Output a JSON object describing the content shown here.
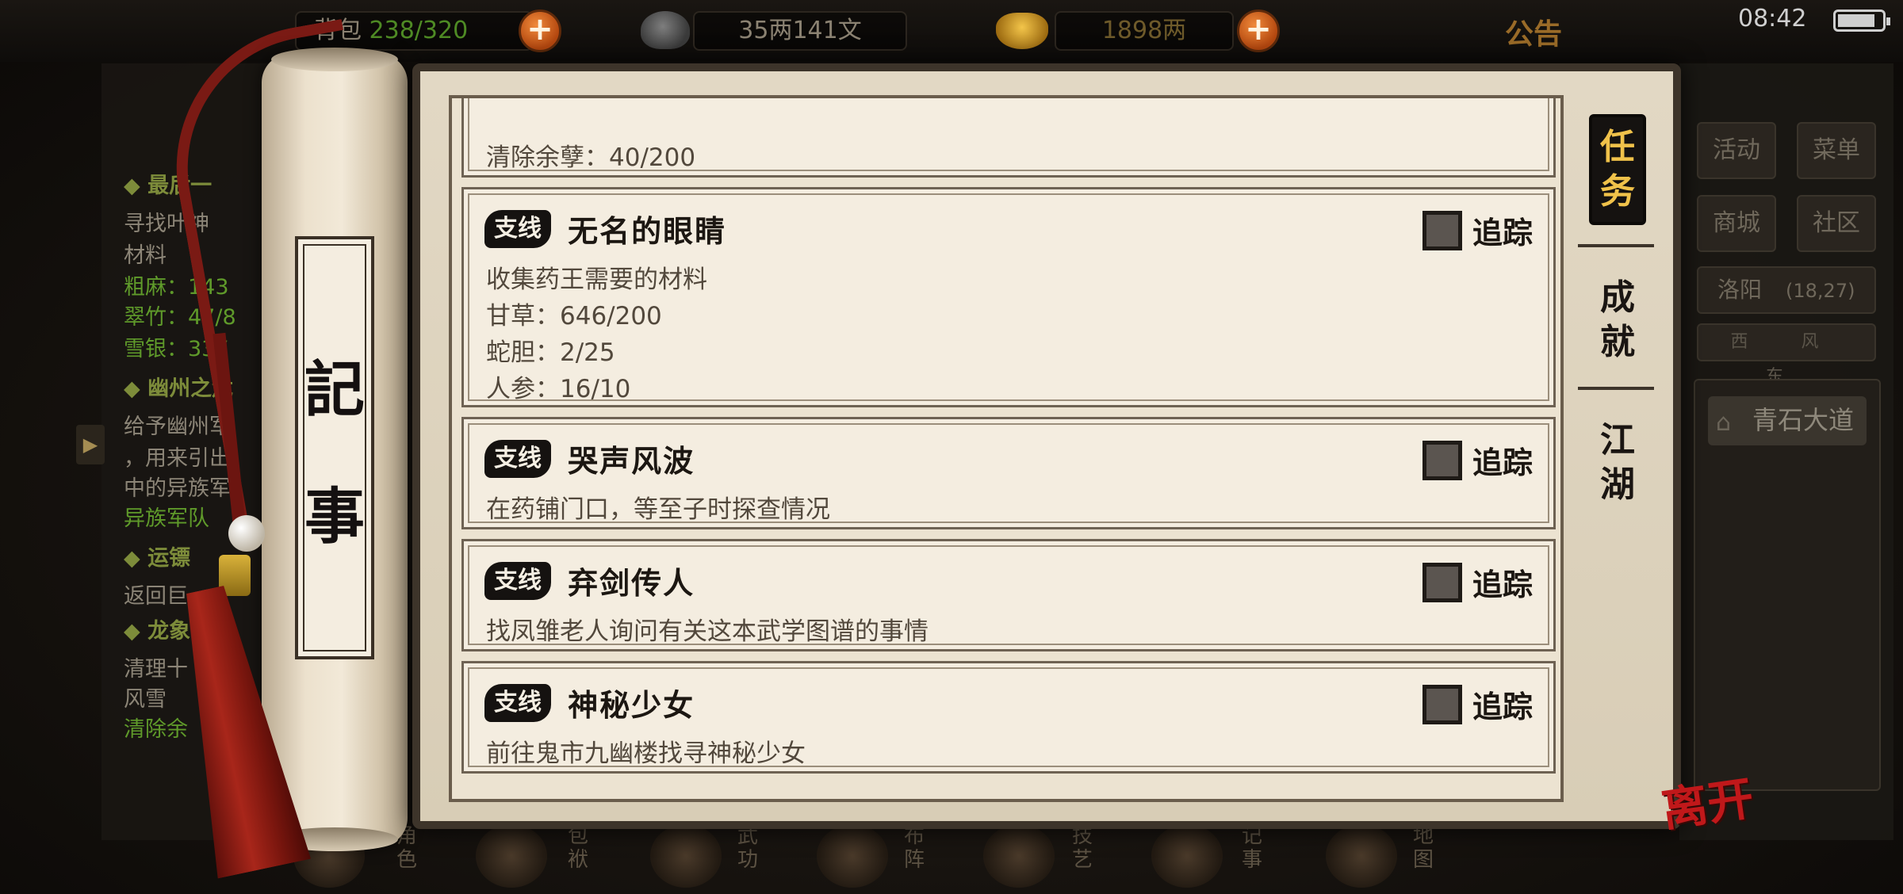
{
  "topbar": {
    "bag_label": "背包",
    "bag_count": "238/320",
    "silver": "35两141文",
    "gold": "1898两",
    "notice": "公告",
    "time": "08:42"
  },
  "left_panel": {
    "quests": [
      {
        "head": "◆ 最后一",
        "lines": [
          "寻找叶神",
          "材料",
          "粗麻：143",
          "翠竹：47/8",
          "雪银：337"
        ]
      },
      {
        "head": "◆ 幽州之危",
        "lines": [
          "给予幽州军",
          "，用来引出",
          "中的异族军",
          "异族军队"
        ]
      },
      {
        "head": "◆ 运镖",
        "lines": [
          "返回巨"
        ]
      },
      {
        "head": "◆ 龙象",
        "lines": [
          "清理十",
          "风雪",
          "清除余"
        ]
      }
    ]
  },
  "right_panel": {
    "activity": "活动",
    "menu": "菜单",
    "shop": "商城",
    "community": "社区",
    "city": "洛阳",
    "coords": "(18,27)",
    "route": "西 风 东",
    "location": "青石大道"
  },
  "bottom_bar": {
    "items": [
      "角色",
      "包袱",
      "武功",
      "布阵",
      "技艺",
      "记事",
      "地图"
    ]
  },
  "scroll_label": [
    "記",
    "事"
  ],
  "tabs": {
    "task": "任务",
    "achievement": "成就",
    "jianghu": "江湖"
  },
  "quests": {
    "partial": {
      "progress": "清除余孽：40/200"
    },
    "q1": {
      "badge": "支线",
      "title": "无名的眼睛",
      "track": "追踪",
      "desc": "收集药王需要的材料",
      "items": [
        "甘草：646/200",
        "蛇胆：2/25",
        "人参：16/10"
      ]
    },
    "q2": {
      "badge": "支线",
      "title": "哭声风波",
      "track": "追踪",
      "desc": "在药铺门口，等至子时探查情况"
    },
    "q3": {
      "badge": "支线",
      "title": "弃剑传人",
      "track": "追踪",
      "desc": "找凤雏老人询问有关这本武学图谱的事情"
    },
    "q4": {
      "badge": "支线",
      "title": "神秘少女",
      "track": "追踪",
      "desc": "前往鬼市九幽楼找寻神秘少女"
    }
  },
  "leave_button": "离开"
}
